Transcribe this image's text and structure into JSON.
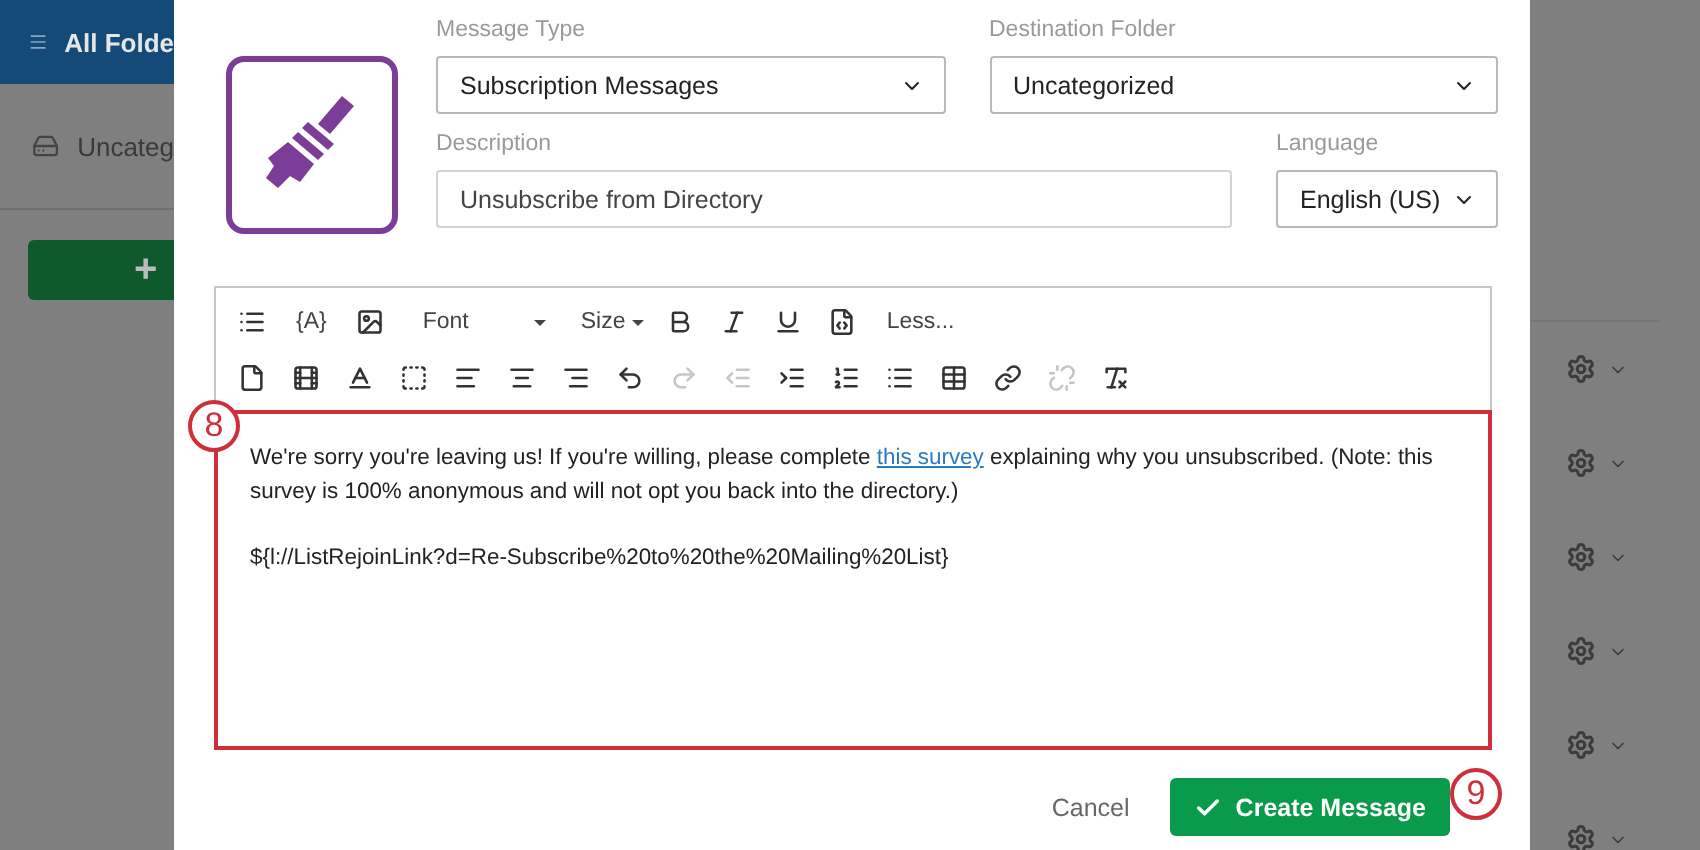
{
  "background_page": {
    "header": {
      "title": "All Folde"
    },
    "folder": {
      "label": "Uncateg"
    },
    "add_button": {
      "label": "+"
    }
  },
  "dialog": {
    "fields": [
      {
        "label": "Message Type",
        "kind": "select",
        "value": "Subscription Messages"
      },
      {
        "label": "Destination Folder",
        "kind": "select",
        "value": "Uncategorized"
      },
      {
        "label": "Description",
        "kind": "input",
        "value": "Unsubscribe from Directory"
      },
      {
        "label": "Language",
        "kind": "select",
        "value": "English (US)"
      }
    ],
    "toolbar": [
      [
        {
          "kind": "icon",
          "disabled": false
        },
        {
          "kind": "text",
          "label": "{A}"
        },
        {
          "kind": "icon",
          "disabled": false
        },
        {
          "kind": "dropdown",
          "label": "Font"
        },
        {
          "kind": "dropdown",
          "label": "Size"
        },
        {
          "kind": "icon",
          "disabled": false
        },
        {
          "kind": "icon",
          "disabled": false
        },
        {
          "kind": "icon",
          "disabled": false
        },
        {
          "kind": "icon",
          "disabled": false
        },
        {
          "kind": "text",
          "label": "Less..."
        }
      ],
      [
        {
          "kind": "icon",
          "disabled": false
        },
        {
          "kind": "icon",
          "disabled": false
        },
        {
          "kind": "icon",
          "disabled": false
        },
        {
          "kind": "icon",
          "disabled": false
        },
        {
          "kind": "icon",
          "disabled": false
        },
        {
          "kind": "icon",
          "disabled": false
        },
        {
          "kind": "icon",
          "disabled": false
        },
        {
          "kind": "icon",
          "disabled": false
        },
        {
          "kind": "icon",
          "disabled": true
        },
        {
          "kind": "icon",
          "disabled": true
        },
        {
          "kind": "icon",
          "disabled": false
        },
        {
          "kind": "icon",
          "disabled": false
        },
        {
          "kind": "icon",
          "disabled": false
        },
        {
          "kind": "icon",
          "disabled": false
        },
        {
          "kind": "icon",
          "disabled": false
        },
        {
          "kind": "icon",
          "disabled": true
        },
        {
          "kind": "icon",
          "disabled": false
        }
      ]
    ],
    "body": {
      "before_link": "We're sorry you're leaving us! If you're willing, please complete ",
      "link": "this survey",
      "after_link": " explaining why you unsubscribed. (Note: this survey is 100% anonymous and will not opt you back into the directory.)",
      "piped_text": "${l://ListRejoinLink?d=Re-Subscribe%20to%20the%20Mailing%20List}"
    },
    "cancel": "Cancel",
    "create": "Create Message"
  },
  "annotations": [
    {
      "label": "8"
    },
    {
      "label": "9"
    }
  ]
}
